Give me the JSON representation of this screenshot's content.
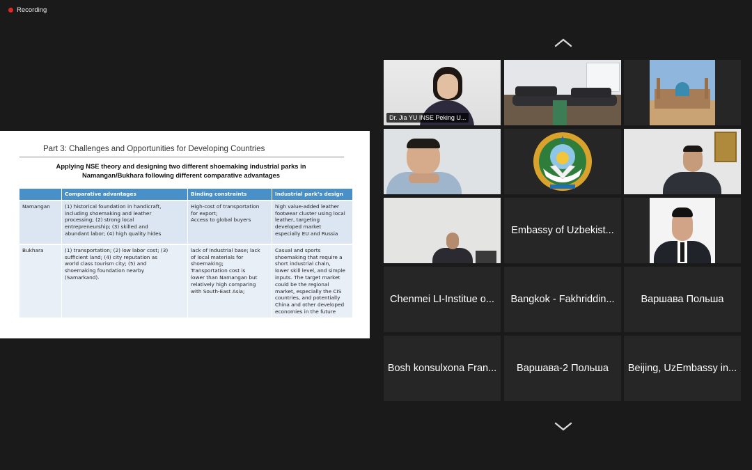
{
  "recording": {
    "label": "Recording"
  },
  "slide": {
    "title": "Part 3: Challenges and Opportunities for Developing Countries",
    "subtitle_line1": "Applying NSE theory and designing two different shoemaking industrial parks in",
    "subtitle_line2": "Namangan/Bukhara following different comparative advantages",
    "table": {
      "headers": [
        "",
        "Comparative advantages",
        "Binding constraints",
        "Industrial park’s design"
      ],
      "rows": [
        {
          "region": "Namangan",
          "advantages": [
            "(1) historical foundation in handicraft,",
            "including shoemaking and leather",
            "processing; (2) strong local",
            "entrepreneurship; (3) skilled and",
            "abundant labor; (4) high quality hides"
          ],
          "constraints": [
            "High-cost of transportation",
            "for export;",
            "Access to global buyers"
          ],
          "design": [
            "high value-added leather",
            "footwear cluster using local",
            "leather, targeting",
            "developed market",
            "especially EU and Russia"
          ]
        },
        {
          "region": "Bukhara",
          "advantages": [
            "(1) transportation; (2) low labor cost; (3)",
            "sufficient land; (4) city reputation as",
            "world class tourism city; (5) and",
            "shoemaking foundation nearby",
            "(Samarkand)."
          ],
          "constraints": [
            "lack of industrial base; lack",
            "of local materials for",
            "shoemaking;",
            "Transportation cost is",
            "lower than Namangan but",
            "relatively high comparing",
            "with South-East Asia;"
          ],
          "design": [
            "Casual and sports",
            "shoemaking that require a",
            "short industrial chain,",
            "lower skill level, and simple",
            "inputs. The target market",
            "could be the regional",
            "market, especially the CIS",
            "countries, and potentially",
            "China and other developed",
            "economies in the future"
          ]
        }
      ]
    }
  },
  "participants": {
    "jia_yu": "Dr. Jia YU INSE Peking U...",
    "embassy": "Embassy of Uzbekist...",
    "chenmei": "Chenmei LI-Institue o...",
    "bangkok": "Bangkok - Fakhriddin...",
    "warsaw": "Варшава Польша",
    "bosh": "Bosh konsulxona Fran...",
    "warsaw2": "Варшава-2 Польша",
    "beijing": "Beijing, UzEmbassy in..."
  },
  "colors": {
    "active_border": "#c7e34a",
    "record_dot": "#e02828",
    "table_header": "#4a90c8"
  },
  "icons": [
    "record-dot-icon",
    "chevron-up-icon",
    "chevron-down-icon",
    "uzbekistan-emblem-icon"
  ]
}
